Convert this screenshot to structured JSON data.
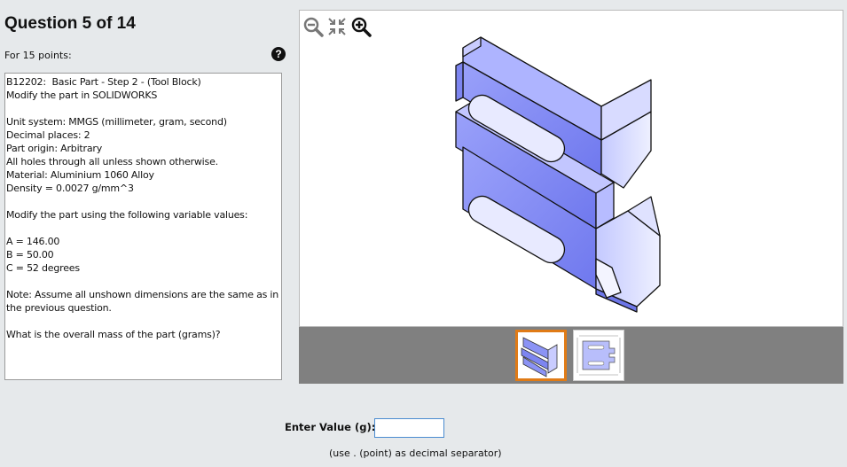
{
  "header": {
    "title": "Question 5 of 14",
    "points": "For 15 points:",
    "help_glyph": "?"
  },
  "question": {
    "lines": [
      "B12202:  Basic Part - Step 2 - (Tool Block)",
      "Modify the part in SOLIDWORKS",
      "",
      "Unit system: MMGS (millimeter, gram, second)",
      "Decimal places: 2",
      "Part origin: Arbitrary",
      "All holes through all unless shown otherwise.",
      "Material: Aluminium 1060 Alloy",
      "Density = 0.0027 g/mm^3",
      "",
      "Modify the part using the following variable values:",
      "",
      "A = 146.00",
      "B = 50.00",
      "C = 52 degrees",
      "",
      "Note: Assume all unshown dimensions are the same as in",
      "the previous question.",
      "",
      "What is the overall mass of the part (grams)?"
    ]
  },
  "viewer": {
    "tools": [
      "zoom-out-icon",
      "fit-to-screen-icon",
      "zoom-in-icon"
    ],
    "thumbnails": [
      {
        "name": "isometric-view-thumbnail",
        "selected": true
      },
      {
        "name": "drawing-view-thumbnail",
        "selected": false
      }
    ],
    "part_color": "#8b93f5",
    "selected_border": "#e07b16"
  },
  "answer": {
    "label": "Enter Value (g):",
    "value": "",
    "hint": "(use . (point) as decimal separator)"
  }
}
